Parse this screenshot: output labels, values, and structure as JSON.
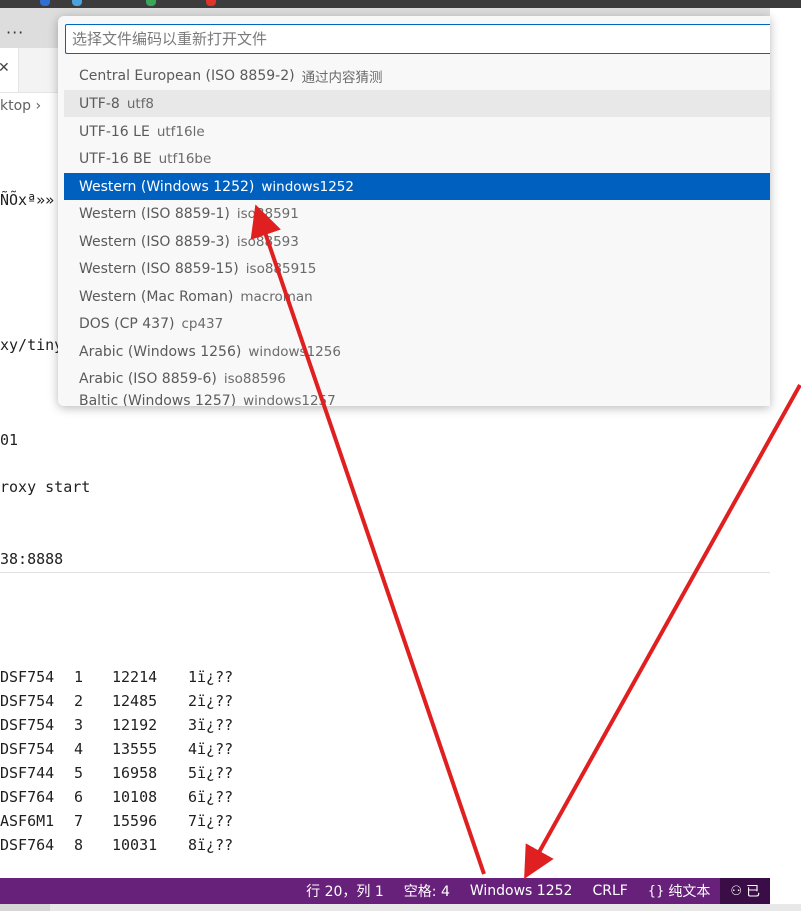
{
  "window": {
    "more_actions": "···"
  },
  "breadcrumb": {
    "fragment": "ktop"
  },
  "editor": {
    "lines": [
      {
        "text": "ÑÕxª»»"
      },
      {
        "text": "xy/tiny"
      },
      {
        "text": "01"
      },
      {
        "text": "roxy start"
      },
      {
        "text": "38:8888"
      }
    ]
  },
  "terminal": {
    "rows": [
      {
        "id": "DSF754",
        "num": "1",
        "val": "12214",
        "label": "1ï¿??"
      },
      {
        "id": "DSF754",
        "num": "2",
        "val": "12485",
        "label": "2ï¿??"
      },
      {
        "id": "DSF754",
        "num": "3",
        "val": "12192",
        "label": "3ï¿??"
      },
      {
        "id": "DSF754",
        "num": "4",
        "val": "13555",
        "label": "4ï¿??"
      },
      {
        "id": "DSF744",
        "num": "5",
        "val": "16958",
        "label": "5ï¿??"
      },
      {
        "id": "DSF764",
        "num": "6",
        "val": "10108",
        "label": "6ï¿??"
      },
      {
        "id": "ASF6M1",
        "num": "7",
        "val": "15596",
        "label": "7ï¿??"
      },
      {
        "id": "DSF764",
        "num": "8",
        "val": "10031",
        "label": "8ï¿??"
      }
    ]
  },
  "picker": {
    "placeholder": "选择文件编码以重新打开文件",
    "items": [
      {
        "label": "Central European (ISO 8859-2)",
        "desc": "通过内容猜测"
      },
      {
        "label": "UTF-8",
        "desc": "utf8"
      },
      {
        "label": "UTF-16 LE",
        "desc": "utf16le"
      },
      {
        "label": "UTF-16 BE",
        "desc": "utf16be"
      },
      {
        "label": "Western (Windows 1252)",
        "desc": "windows1252"
      },
      {
        "label": "Western (ISO 8859-1)",
        "desc": "iso88591"
      },
      {
        "label": "Western (ISO 8859-3)",
        "desc": "iso88593"
      },
      {
        "label": "Western (ISO 8859-15)",
        "desc": "iso885915"
      },
      {
        "label": "Western (Mac Roman)",
        "desc": "macroman"
      },
      {
        "label": "DOS (CP 437)",
        "desc": "cp437"
      },
      {
        "label": "Arabic (Windows 1256)",
        "desc": "windows1256"
      },
      {
        "label": "Arabic (ISO 8859-6)",
        "desc": "iso88596"
      },
      {
        "label": "Baltic (Windows 1257)",
        "desc": "windows1257"
      }
    ]
  },
  "status_bar": {
    "position": "行 20，列 1",
    "indent": "空格: 4",
    "encoding": "Windows 1252",
    "eol": "CRLF",
    "language": "纯文本",
    "notice": "已",
    "color": "#68217a"
  },
  "annotation": {
    "arrow_color": "#e02020"
  }
}
